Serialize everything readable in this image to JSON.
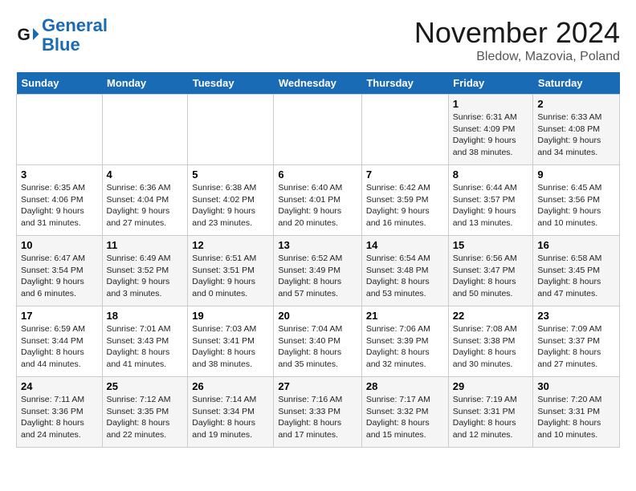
{
  "header": {
    "logo_line1": "General",
    "logo_line2": "Blue",
    "month": "November 2024",
    "location": "Bledow, Mazovia, Poland"
  },
  "weekdays": [
    "Sunday",
    "Monday",
    "Tuesday",
    "Wednesday",
    "Thursday",
    "Friday",
    "Saturday"
  ],
  "weeks": [
    [
      {
        "day": "",
        "info": ""
      },
      {
        "day": "",
        "info": ""
      },
      {
        "day": "",
        "info": ""
      },
      {
        "day": "",
        "info": ""
      },
      {
        "day": "",
        "info": ""
      },
      {
        "day": "1",
        "info": "Sunrise: 6:31 AM\nSunset: 4:09 PM\nDaylight: 9 hours\nand 38 minutes."
      },
      {
        "day": "2",
        "info": "Sunrise: 6:33 AM\nSunset: 4:08 PM\nDaylight: 9 hours\nand 34 minutes."
      }
    ],
    [
      {
        "day": "3",
        "info": "Sunrise: 6:35 AM\nSunset: 4:06 PM\nDaylight: 9 hours\nand 31 minutes."
      },
      {
        "day": "4",
        "info": "Sunrise: 6:36 AM\nSunset: 4:04 PM\nDaylight: 9 hours\nand 27 minutes."
      },
      {
        "day": "5",
        "info": "Sunrise: 6:38 AM\nSunset: 4:02 PM\nDaylight: 9 hours\nand 23 minutes."
      },
      {
        "day": "6",
        "info": "Sunrise: 6:40 AM\nSunset: 4:01 PM\nDaylight: 9 hours\nand 20 minutes."
      },
      {
        "day": "7",
        "info": "Sunrise: 6:42 AM\nSunset: 3:59 PM\nDaylight: 9 hours\nand 16 minutes."
      },
      {
        "day": "8",
        "info": "Sunrise: 6:44 AM\nSunset: 3:57 PM\nDaylight: 9 hours\nand 13 minutes."
      },
      {
        "day": "9",
        "info": "Sunrise: 6:45 AM\nSunset: 3:56 PM\nDaylight: 9 hours\nand 10 minutes."
      }
    ],
    [
      {
        "day": "10",
        "info": "Sunrise: 6:47 AM\nSunset: 3:54 PM\nDaylight: 9 hours\nand 6 minutes."
      },
      {
        "day": "11",
        "info": "Sunrise: 6:49 AM\nSunset: 3:52 PM\nDaylight: 9 hours\nand 3 minutes."
      },
      {
        "day": "12",
        "info": "Sunrise: 6:51 AM\nSunset: 3:51 PM\nDaylight: 9 hours\nand 0 minutes."
      },
      {
        "day": "13",
        "info": "Sunrise: 6:52 AM\nSunset: 3:49 PM\nDaylight: 8 hours\nand 57 minutes."
      },
      {
        "day": "14",
        "info": "Sunrise: 6:54 AM\nSunset: 3:48 PM\nDaylight: 8 hours\nand 53 minutes."
      },
      {
        "day": "15",
        "info": "Sunrise: 6:56 AM\nSunset: 3:47 PM\nDaylight: 8 hours\nand 50 minutes."
      },
      {
        "day": "16",
        "info": "Sunrise: 6:58 AM\nSunset: 3:45 PM\nDaylight: 8 hours\nand 47 minutes."
      }
    ],
    [
      {
        "day": "17",
        "info": "Sunrise: 6:59 AM\nSunset: 3:44 PM\nDaylight: 8 hours\nand 44 minutes."
      },
      {
        "day": "18",
        "info": "Sunrise: 7:01 AM\nSunset: 3:43 PM\nDaylight: 8 hours\nand 41 minutes."
      },
      {
        "day": "19",
        "info": "Sunrise: 7:03 AM\nSunset: 3:41 PM\nDaylight: 8 hours\nand 38 minutes."
      },
      {
        "day": "20",
        "info": "Sunrise: 7:04 AM\nSunset: 3:40 PM\nDaylight: 8 hours\nand 35 minutes."
      },
      {
        "day": "21",
        "info": "Sunrise: 7:06 AM\nSunset: 3:39 PM\nDaylight: 8 hours\nand 32 minutes."
      },
      {
        "day": "22",
        "info": "Sunrise: 7:08 AM\nSunset: 3:38 PM\nDaylight: 8 hours\nand 30 minutes."
      },
      {
        "day": "23",
        "info": "Sunrise: 7:09 AM\nSunset: 3:37 PM\nDaylight: 8 hours\nand 27 minutes."
      }
    ],
    [
      {
        "day": "24",
        "info": "Sunrise: 7:11 AM\nSunset: 3:36 PM\nDaylight: 8 hours\nand 24 minutes."
      },
      {
        "day": "25",
        "info": "Sunrise: 7:12 AM\nSunset: 3:35 PM\nDaylight: 8 hours\nand 22 minutes."
      },
      {
        "day": "26",
        "info": "Sunrise: 7:14 AM\nSunset: 3:34 PM\nDaylight: 8 hours\nand 19 minutes."
      },
      {
        "day": "27",
        "info": "Sunrise: 7:16 AM\nSunset: 3:33 PM\nDaylight: 8 hours\nand 17 minutes."
      },
      {
        "day": "28",
        "info": "Sunrise: 7:17 AM\nSunset: 3:32 PM\nDaylight: 8 hours\nand 15 minutes."
      },
      {
        "day": "29",
        "info": "Sunrise: 7:19 AM\nSunset: 3:31 PM\nDaylight: 8 hours\nand 12 minutes."
      },
      {
        "day": "30",
        "info": "Sunrise: 7:20 AM\nSunset: 3:31 PM\nDaylight: 8 hours\nand 10 minutes."
      }
    ]
  ]
}
